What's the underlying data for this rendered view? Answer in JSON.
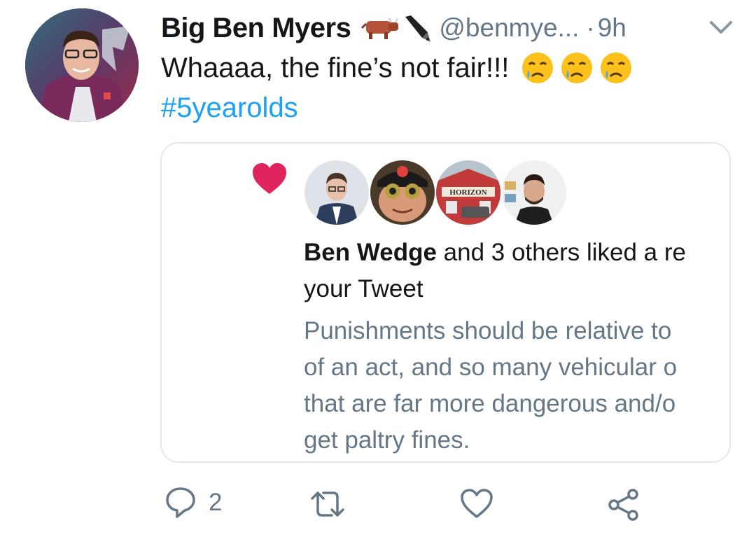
{
  "tweet": {
    "author_name": "Big Ben Myers",
    "handle": "@benmye...",
    "separator": "·",
    "time": "9h",
    "text": "Whaaaa, the fine’s not fair!!!",
    "hashtag": "#5yearolds",
    "badge_icons": [
      "cow-icon",
      "pen-icon"
    ],
    "text_emojis": [
      "crying-face-icon",
      "crying-face-icon",
      "crying-face-icon"
    ]
  },
  "quote_card": {
    "liker_avatars": [
      "avatar-suit-man",
      "avatar-binoculars",
      "avatar-horizon-building",
      "avatar-bearded-man"
    ],
    "notification_name": "Ben Wedge",
    "notification_rest": " and 3 others liked a re",
    "notification_line2": "your Tweet",
    "quoted_lines": [
      "Punishments should be relative to",
      "of an act, and so many vehicular o",
      "that are far more dangerous and/o",
      "get paltry fines."
    ],
    "horizon_sign": "HORIZON"
  },
  "actions": {
    "reply_count": "2",
    "icons": [
      "reply-icon",
      "retweet-icon",
      "like-icon",
      "share-icon"
    ]
  },
  "colors": {
    "link": "#1da1f2",
    "secondary_text": "#657786",
    "heart": "#e0245e",
    "border": "#e1e8ed"
  }
}
